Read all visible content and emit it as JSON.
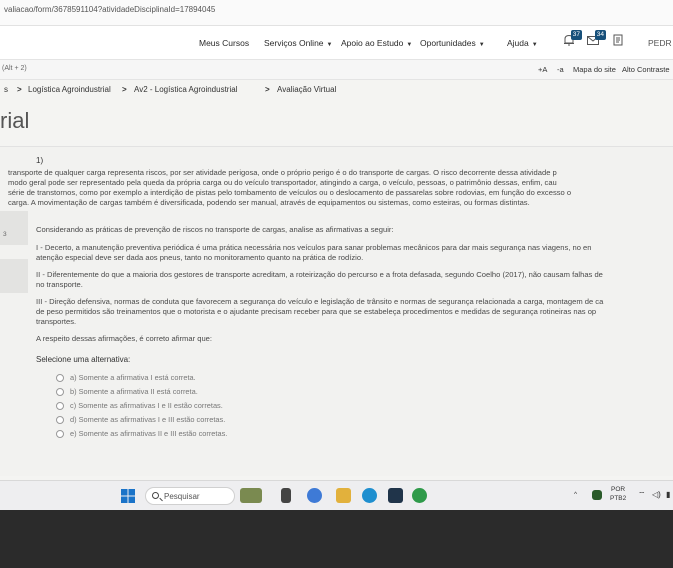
{
  "browser": {
    "url": "valiacao/form/3678591104?atividadeDisciplinaId=17894045"
  },
  "nav": {
    "items": [
      {
        "label": "Meus Cursos",
        "caret": false
      },
      {
        "label": "Serviços Online",
        "caret": true
      },
      {
        "label": "Apoio ao Estudo",
        "caret": true
      },
      {
        "label": "Oportunidades",
        "caret": true
      },
      {
        "label": "Ajuda",
        "caret": true
      }
    ],
    "messages_badge": "37",
    "notifications_badge": "34",
    "user_label": "PEDR"
  },
  "utility": {
    "left_hint": "(Alt + 2)",
    "increase_font": "+A",
    "decrease_font": "-a",
    "site_map": "Mapa do site",
    "high_contrast": "Alto Contraste"
  },
  "breadcrumb": {
    "items": [
      "Logística Agroindustrial",
      "Av2 - Logística Agroindustrial",
      "Avaliação Virtual"
    ],
    "separator": ">"
  },
  "page": {
    "title_fragment": "rial"
  },
  "question": {
    "number": "1)",
    "side_number": "3",
    "paragraph_lines": [
      "transporte de qualquer carga representa riscos, por ser atividade perigosa, onde o próprio perigo é o do transporte de cargas. O risco decorrente dessa atividade p",
      "modo geral pode ser representado pela queda da própria carga ou do veículo transportador, atingindo a carga, o veículo, pessoas, o patrimônio dessas, enfim, cau",
      "série de transtornos, como por exemplo a interdição de pistas pelo tombamento de veículos ou o deslocamento de passarelas sobre rodovias, em função do excesso o",
      "carga. A movimentação de cargas também é diversificada, podendo ser manual, através de equipamentos ou sistemas, como esteiras, ou formas distintas."
    ],
    "prompt": "Considerando as práticas de prevenção de riscos no transporte de cargas, analise as afirmativas a seguir:",
    "statement_1_lines": [
      "I - Decerto, a manutenção preventiva periódica é uma prática necessária nos veículos para sanar problemas mecânicos para dar mais segurança nas viagens, no en",
      "atenção especial deve ser dada aos pneus, tanto no monitoramento quanto na prática de rodízio."
    ],
    "statement_2_lines": [
      "II - Diferentemente do que a maioria dos gestores de transporte acreditam, a roteirização do percurso e a frota defasada, segundo Coelho (2017), não causam falhas de",
      "no transporte."
    ],
    "statement_3_lines": [
      "III - Direção defensiva, normas de conduta que favorecem a segurança do veículo e legislação de trânsito e normas de segurança relacionada a carga, montagem de ca",
      "de peso permitidos são treinamentos que o motorista e o ajudante precisam receber para que se estabeleça procedimentos e medidas de segurança rotineiras nas op",
      "transportes."
    ],
    "closing": "A respeito dessas afirmações, é correto afirmar que:",
    "select_label": "Selecione uma alternativa:",
    "options": [
      "a) Somente a afirmativa I está correta.",
      "b) Somente a afirmativa II está correta.",
      "c) Somente as afirmativas I e II estão corretas.",
      "d) Somente as afirmativas I e III estão corretas.",
      "e)  Somente as afirmativas II e III estão corretas."
    ]
  },
  "taskbar": {
    "search_placeholder": "Pesquisar",
    "language": "POR",
    "layout": "PTB2"
  },
  "colors": {
    "badge": "#17507a",
    "question_bg": "#f2f2f0"
  }
}
